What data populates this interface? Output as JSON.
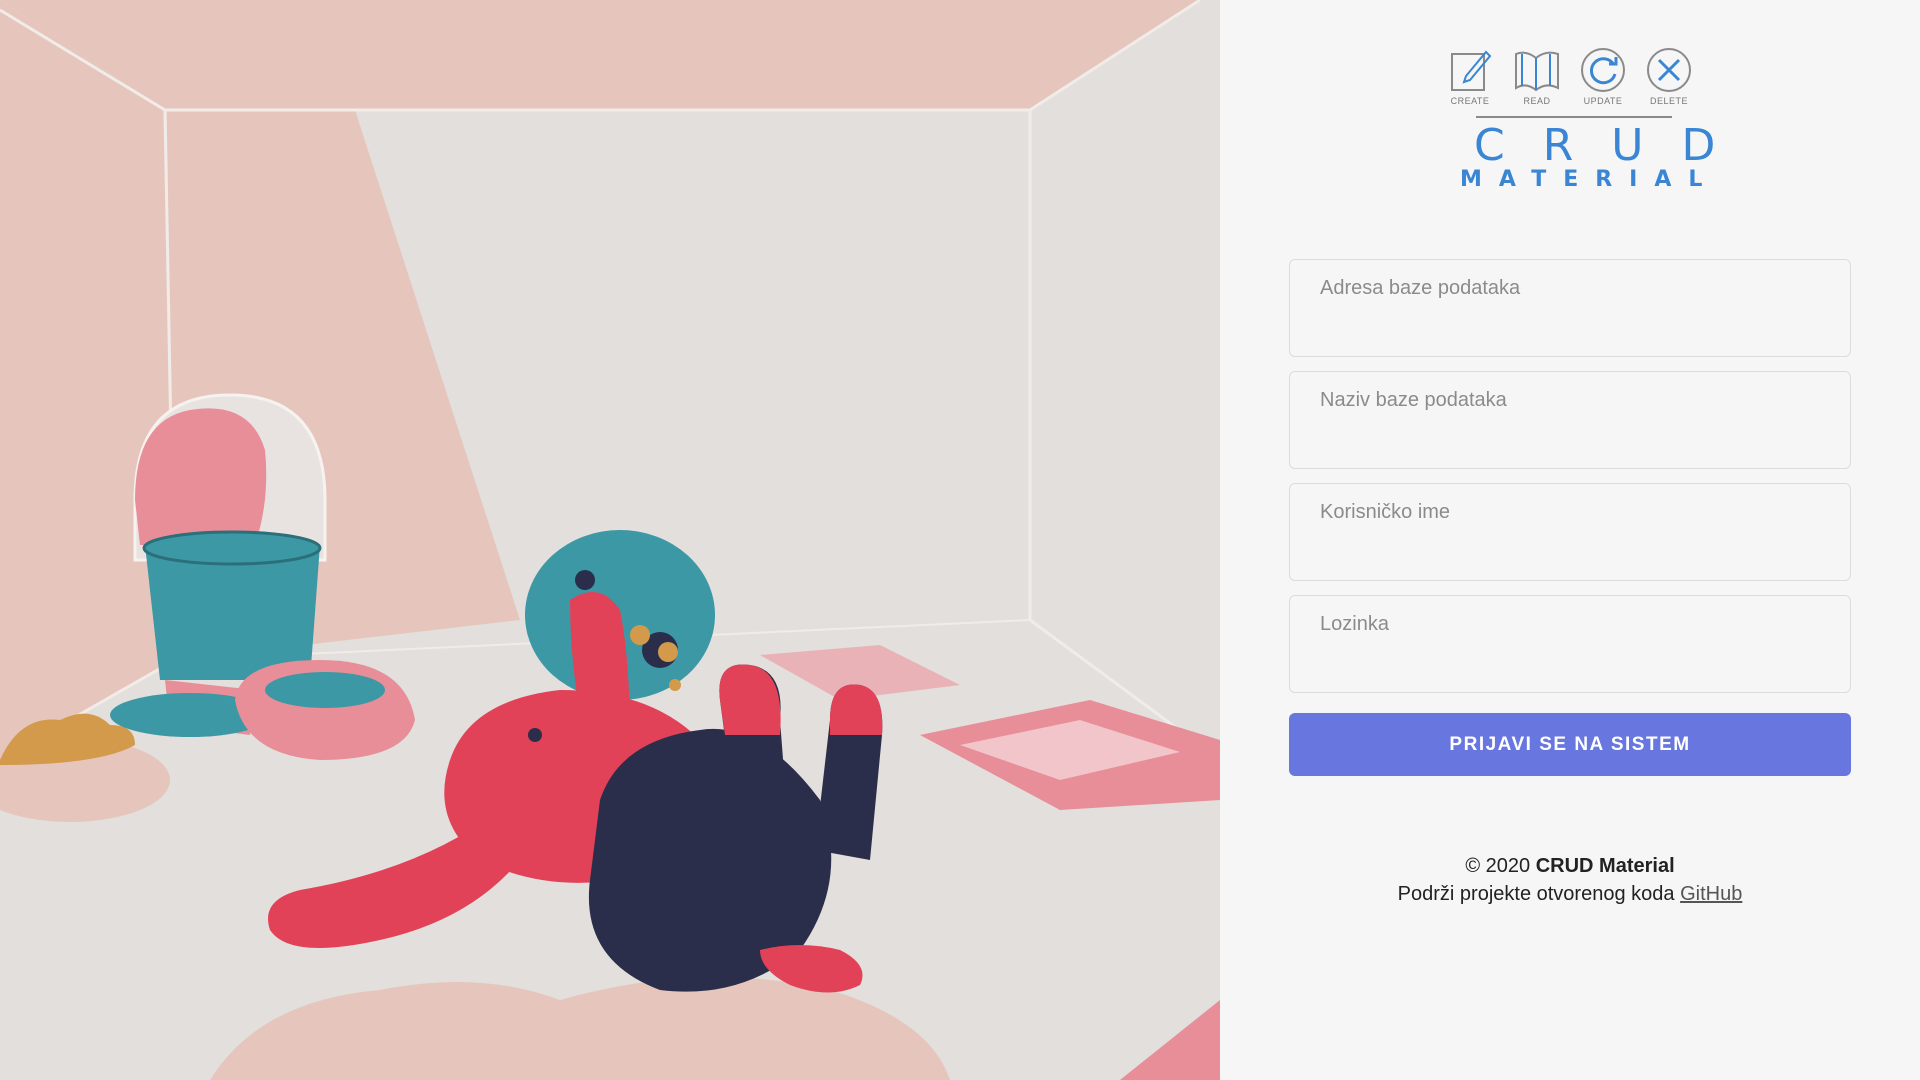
{
  "illustration": {
    "description_name": "dog-in-room-illustration",
    "colors": {
      "floor": "#e2dfdc",
      "walls": "#e6c6bc",
      "dog_red": "#e24257",
      "dog_navy": "#2a2e4a",
      "cone_teal": "#3c98a4",
      "food_bowl": "#d39a4c",
      "pink": "#e78e98"
    }
  },
  "logo": {
    "icons": [
      {
        "name": "create-icon",
        "label": "CREATE"
      },
      {
        "name": "read-icon",
        "label": "READ"
      },
      {
        "name": "update-icon",
        "label": "UPDATE"
      },
      {
        "name": "delete-icon",
        "label": "DELETE"
      }
    ],
    "word_main": "CRUD",
    "word_sub": "MATERIAL",
    "color": "#3a86d4"
  },
  "form": {
    "db_address_placeholder": "Adresa baze podataka",
    "db_name_placeholder": "Naziv baze podataka",
    "username_placeholder": "Korisničko ime",
    "password_placeholder": "Lozinka",
    "submit_label": "PRIJAVI SE NA SISTEM",
    "submit_color": "#6876e0"
  },
  "footer": {
    "copyright_prefix": "© 2020",
    "brand": "CRUD Material",
    "support_text": "Podrži projekte otvorenog koda",
    "link_label": "GitHub"
  }
}
